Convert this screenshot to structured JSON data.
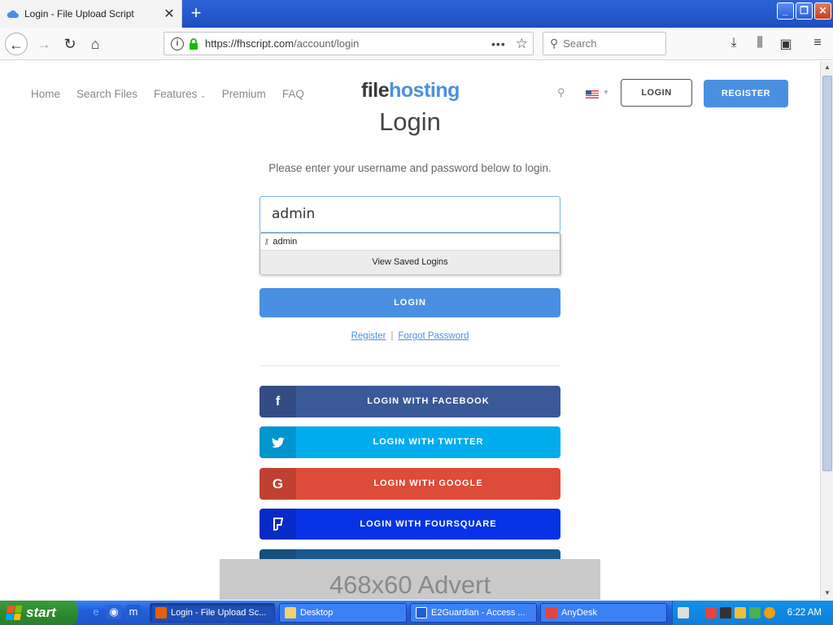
{
  "browser": {
    "tab_title": "Login - File Upload Script",
    "url_host": "https://fhscript.com",
    "url_path": "/account/login",
    "search_placeholder": "Search"
  },
  "site": {
    "nav": [
      "Home",
      "Search Files",
      "Features",
      "Premium",
      "FAQ"
    ],
    "logo_part1": "file",
    "logo_part2": "hosting",
    "login_button": "LOGIN",
    "register_button": "REGISTER"
  },
  "login": {
    "title": "Login",
    "intro": "Please enter your username and password below to login.",
    "username_value": "admin",
    "autocomplete_item": "admin",
    "autocomplete_footer": "View Saved Logins",
    "submit": "LOGIN",
    "register_link": "Register",
    "separator": "|",
    "forgot_link": "Forgot Password"
  },
  "social": {
    "facebook": "LOGIN WITH FACEBOOK",
    "twitter": "LOGIN WITH TWITTER",
    "google": "LOGIN WITH GOOGLE",
    "foursquare": "LOGIN WITH FOURSQUARE"
  },
  "advert": "468x60 Advert",
  "taskbar": {
    "start": "start",
    "tasks": [
      "Login - File Upload Sc...",
      "Desktop",
      "E2Guardian - Access ...",
      "AnyDesk"
    ],
    "clock": "6:22 AM"
  },
  "colors": {
    "primary": "#4a90e2",
    "facebook": "#3b5998",
    "twitter": "#00aced",
    "google": "#dd4b39",
    "foursquare": "#0732e5"
  }
}
